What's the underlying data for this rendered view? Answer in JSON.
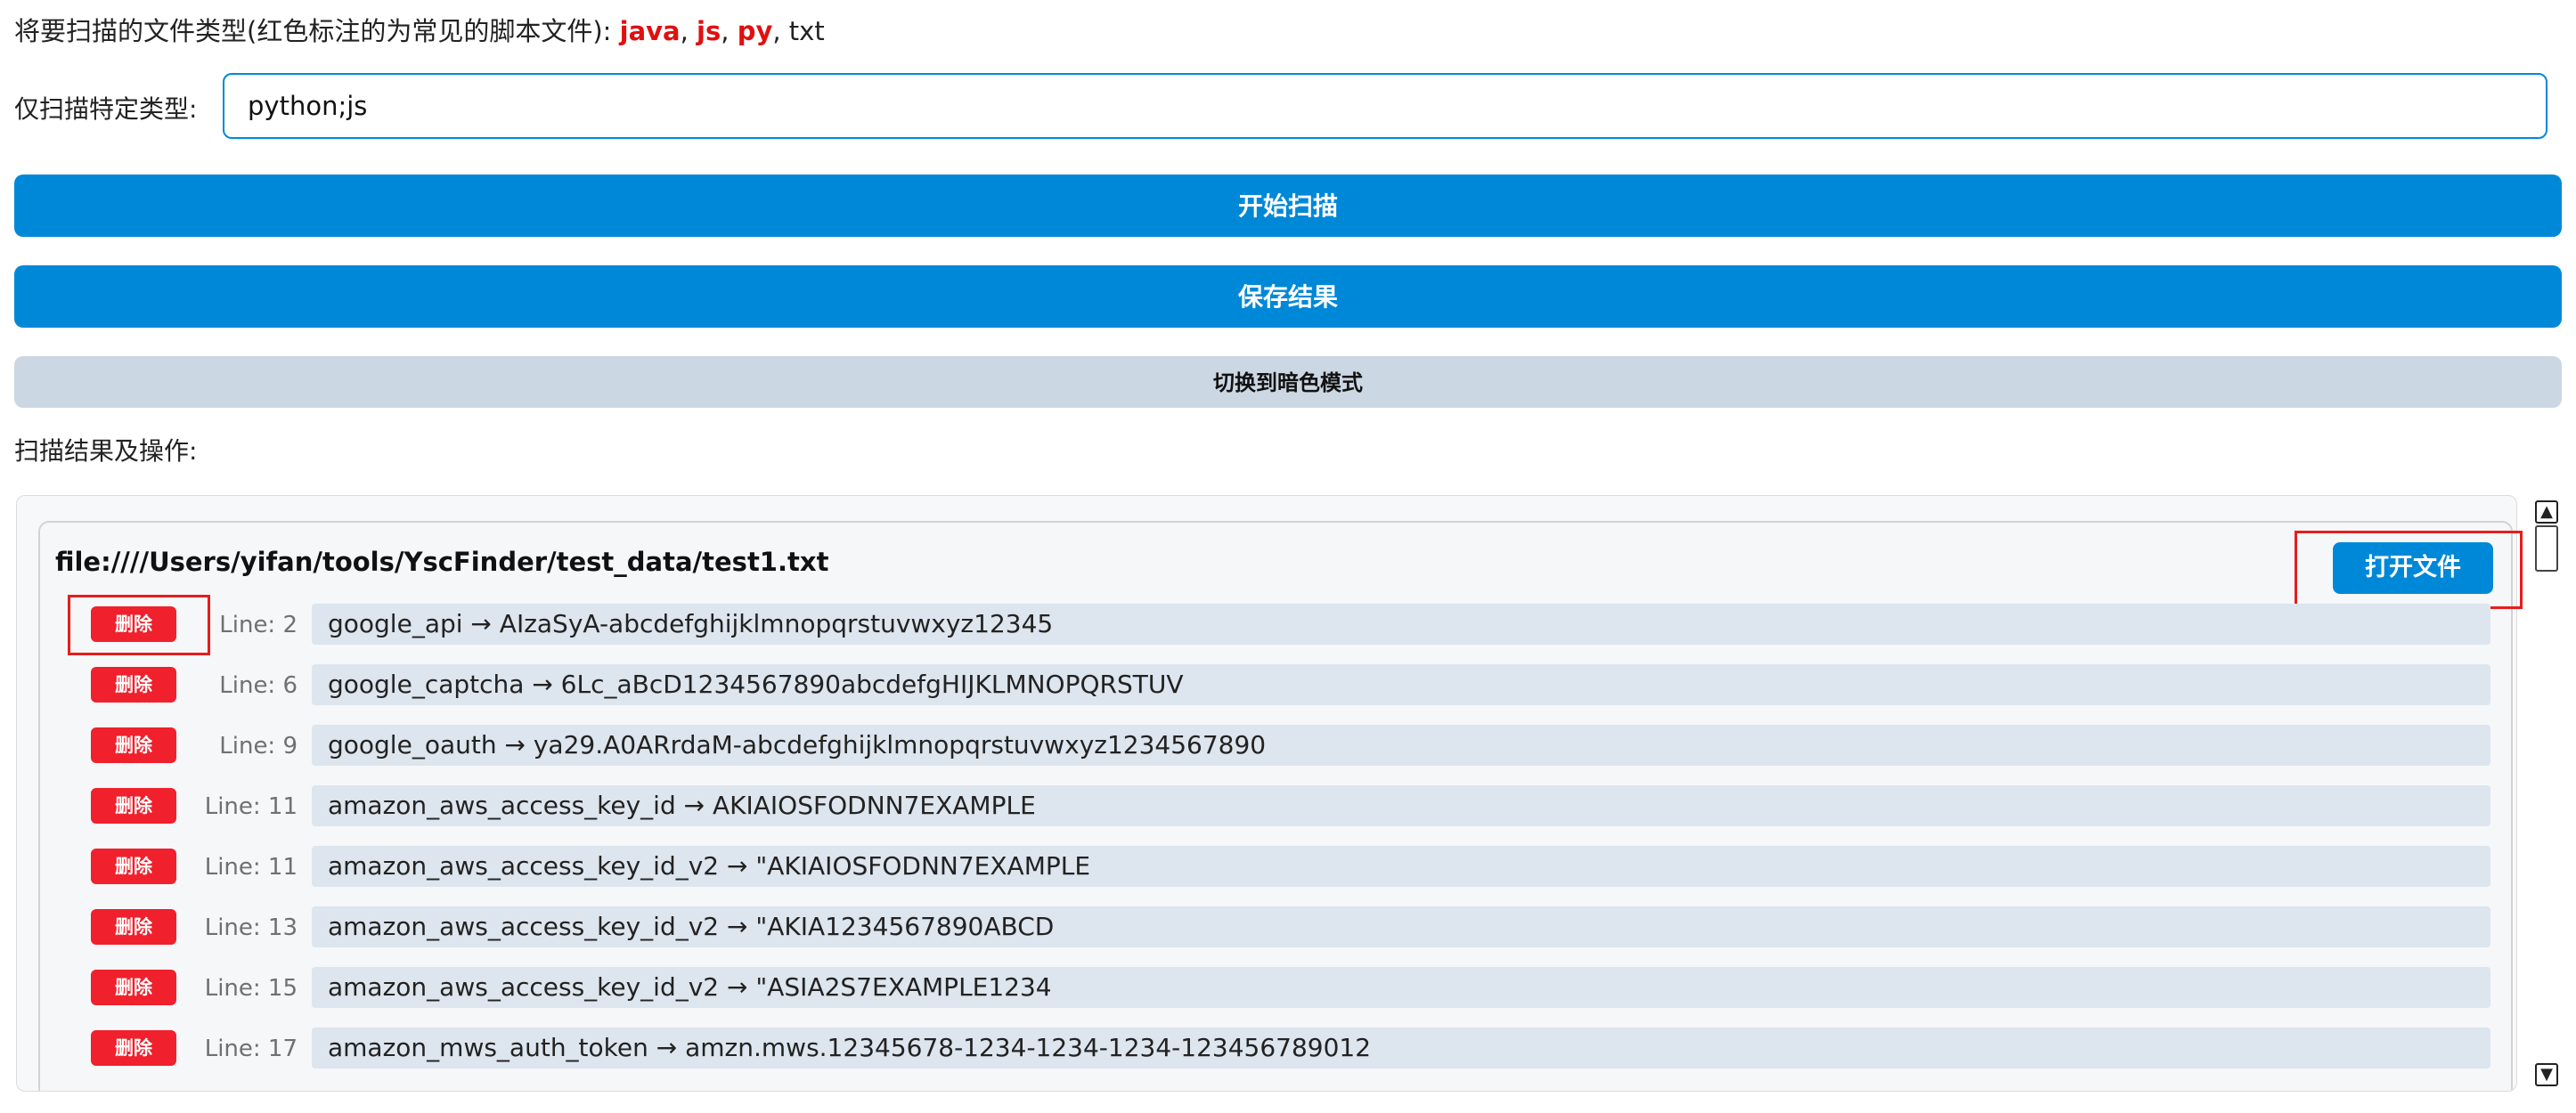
{
  "file_types": {
    "prefix": "将要扫描的文件类型(红色标注的为常见的脚本文件): ",
    "script_types": [
      "java",
      "js",
      "py"
    ],
    "separator": ", ",
    "other_types": [
      "txt"
    ]
  },
  "only_type": {
    "label": "仅扫描特定类型:",
    "value": "python;js"
  },
  "buttons": {
    "start_scan": "开始扫描",
    "save_results": "保存结果",
    "dark_mode": "切换到暗色模式"
  },
  "results": {
    "title": "扫描结果及操作:",
    "files": [
      {
        "path": "file:////Users/yifan/tools/YscFinder/test_data/test1.txt",
        "open_label": "打开文件",
        "items": [
          {
            "delete_label": "删除",
            "line": "Line: 2",
            "text": "google_api → AIzaSyA-abcdefghijklmnopqrstuvwxyz12345"
          },
          {
            "delete_label": "删除",
            "line": "Line: 6",
            "text": "google_captcha → 6Lc_aBcD1234567890abcdefgHIJKLMNOPQRSTUV"
          },
          {
            "delete_label": "删除",
            "line": "Line: 9",
            "text": "google_oauth → ya29.A0ARrdaM-abcdefghijklmnopqrstuvwxyz1234567890"
          },
          {
            "delete_label": "删除",
            "line": "Line: 11",
            "text": "amazon_aws_access_key_id → AKIAIOSFODNN7EXAMPLE"
          },
          {
            "delete_label": "删除",
            "line": "Line: 11",
            "text": "amazon_aws_access_key_id_v2 → \"AKIAIOSFODNN7EXAMPLE"
          },
          {
            "delete_label": "删除",
            "line": "Line: 13",
            "text": "amazon_aws_access_key_id_v2 → \"AKIA1234567890ABCD"
          },
          {
            "delete_label": "删除",
            "line": "Line: 15",
            "text": "amazon_aws_access_key_id_v2 → \"ASIA2S7EXAMPLE1234"
          },
          {
            "delete_label": "删除",
            "line": "Line: 17",
            "text": "amazon_mws_auth_token → amzn.mws.12345678-1234-1234-1234-123456789012"
          }
        ]
      }
    ]
  },
  "scrollbar": {
    "up_icon": "▲",
    "down_icon": "▼"
  },
  "colors": {
    "primary": "#0088d8",
    "danger": "#f0202c",
    "highlight_red": "#e01010",
    "item_bg": "#dde5ee",
    "dark_mode_button": "#cbd7e2"
  }
}
